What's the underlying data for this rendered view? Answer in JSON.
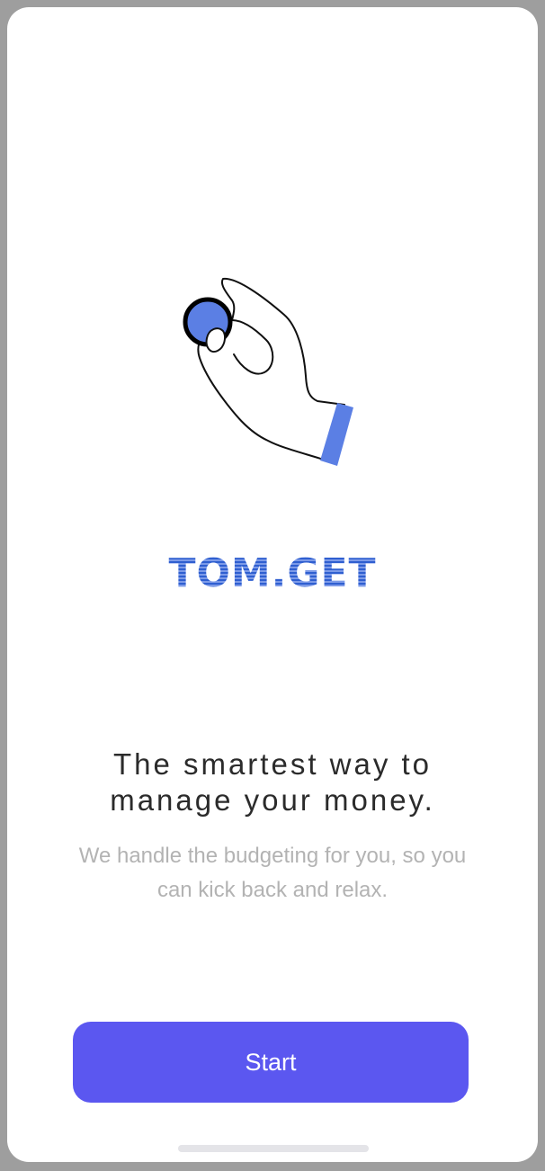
{
  "app": {
    "logo_text": "TOM.GET"
  },
  "onboarding": {
    "illustration": "hand-holding-coin-icon",
    "headline_line1": "The smartest way to",
    "headline_line2": "manage your money.",
    "subtext_line1": "We handle the budgeting for you, so you",
    "subtext_line2": "can kick back and relax.",
    "start_label": "Start"
  },
  "colors": {
    "accent": "#5b57f0",
    "logo_blue": "#4f79dc",
    "coin_blue": "#5b7fe4",
    "headline": "#2b2b2b",
    "subtext": "#b3b3b3"
  }
}
